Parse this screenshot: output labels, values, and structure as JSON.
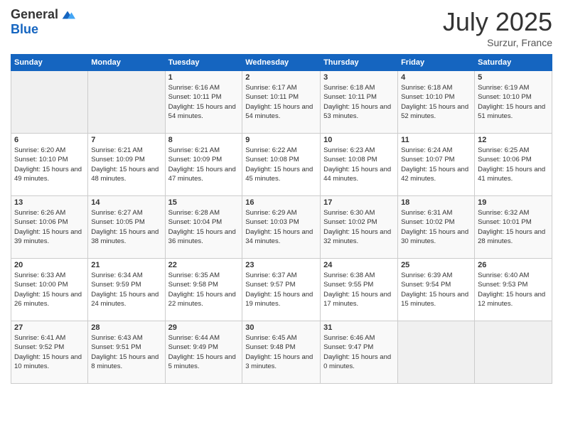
{
  "logo": {
    "general": "General",
    "blue": "Blue"
  },
  "header": {
    "month": "July 2025",
    "location": "Surzur, France"
  },
  "weekdays": [
    "Sunday",
    "Monday",
    "Tuesday",
    "Wednesday",
    "Thursday",
    "Friday",
    "Saturday"
  ],
  "weeks": [
    [
      {
        "day": "",
        "info": ""
      },
      {
        "day": "",
        "info": ""
      },
      {
        "day": "1",
        "info": "Sunrise: 6:16 AM\nSunset: 10:11 PM\nDaylight: 15 hours and 54 minutes."
      },
      {
        "day": "2",
        "info": "Sunrise: 6:17 AM\nSunset: 10:11 PM\nDaylight: 15 hours and 54 minutes."
      },
      {
        "day": "3",
        "info": "Sunrise: 6:18 AM\nSunset: 10:11 PM\nDaylight: 15 hours and 53 minutes."
      },
      {
        "day": "4",
        "info": "Sunrise: 6:18 AM\nSunset: 10:10 PM\nDaylight: 15 hours and 52 minutes."
      },
      {
        "day": "5",
        "info": "Sunrise: 6:19 AM\nSunset: 10:10 PM\nDaylight: 15 hours and 51 minutes."
      }
    ],
    [
      {
        "day": "6",
        "info": "Sunrise: 6:20 AM\nSunset: 10:10 PM\nDaylight: 15 hours and 49 minutes."
      },
      {
        "day": "7",
        "info": "Sunrise: 6:21 AM\nSunset: 10:09 PM\nDaylight: 15 hours and 48 minutes."
      },
      {
        "day": "8",
        "info": "Sunrise: 6:21 AM\nSunset: 10:09 PM\nDaylight: 15 hours and 47 minutes."
      },
      {
        "day": "9",
        "info": "Sunrise: 6:22 AM\nSunset: 10:08 PM\nDaylight: 15 hours and 45 minutes."
      },
      {
        "day": "10",
        "info": "Sunrise: 6:23 AM\nSunset: 10:08 PM\nDaylight: 15 hours and 44 minutes."
      },
      {
        "day": "11",
        "info": "Sunrise: 6:24 AM\nSunset: 10:07 PM\nDaylight: 15 hours and 42 minutes."
      },
      {
        "day": "12",
        "info": "Sunrise: 6:25 AM\nSunset: 10:06 PM\nDaylight: 15 hours and 41 minutes."
      }
    ],
    [
      {
        "day": "13",
        "info": "Sunrise: 6:26 AM\nSunset: 10:06 PM\nDaylight: 15 hours and 39 minutes."
      },
      {
        "day": "14",
        "info": "Sunrise: 6:27 AM\nSunset: 10:05 PM\nDaylight: 15 hours and 38 minutes."
      },
      {
        "day": "15",
        "info": "Sunrise: 6:28 AM\nSunset: 10:04 PM\nDaylight: 15 hours and 36 minutes."
      },
      {
        "day": "16",
        "info": "Sunrise: 6:29 AM\nSunset: 10:03 PM\nDaylight: 15 hours and 34 minutes."
      },
      {
        "day": "17",
        "info": "Sunrise: 6:30 AM\nSunset: 10:02 PM\nDaylight: 15 hours and 32 minutes."
      },
      {
        "day": "18",
        "info": "Sunrise: 6:31 AM\nSunset: 10:02 PM\nDaylight: 15 hours and 30 minutes."
      },
      {
        "day": "19",
        "info": "Sunrise: 6:32 AM\nSunset: 10:01 PM\nDaylight: 15 hours and 28 minutes."
      }
    ],
    [
      {
        "day": "20",
        "info": "Sunrise: 6:33 AM\nSunset: 10:00 PM\nDaylight: 15 hours and 26 minutes."
      },
      {
        "day": "21",
        "info": "Sunrise: 6:34 AM\nSunset: 9:59 PM\nDaylight: 15 hours and 24 minutes."
      },
      {
        "day": "22",
        "info": "Sunrise: 6:35 AM\nSunset: 9:58 PM\nDaylight: 15 hours and 22 minutes."
      },
      {
        "day": "23",
        "info": "Sunrise: 6:37 AM\nSunset: 9:57 PM\nDaylight: 15 hours and 19 minutes."
      },
      {
        "day": "24",
        "info": "Sunrise: 6:38 AM\nSunset: 9:55 PM\nDaylight: 15 hours and 17 minutes."
      },
      {
        "day": "25",
        "info": "Sunrise: 6:39 AM\nSunset: 9:54 PM\nDaylight: 15 hours and 15 minutes."
      },
      {
        "day": "26",
        "info": "Sunrise: 6:40 AM\nSunset: 9:53 PM\nDaylight: 15 hours and 12 minutes."
      }
    ],
    [
      {
        "day": "27",
        "info": "Sunrise: 6:41 AM\nSunset: 9:52 PM\nDaylight: 15 hours and 10 minutes."
      },
      {
        "day": "28",
        "info": "Sunrise: 6:43 AM\nSunset: 9:51 PM\nDaylight: 15 hours and 8 minutes."
      },
      {
        "day": "29",
        "info": "Sunrise: 6:44 AM\nSunset: 9:49 PM\nDaylight: 15 hours and 5 minutes."
      },
      {
        "day": "30",
        "info": "Sunrise: 6:45 AM\nSunset: 9:48 PM\nDaylight: 15 hours and 3 minutes."
      },
      {
        "day": "31",
        "info": "Sunrise: 6:46 AM\nSunset: 9:47 PM\nDaylight: 15 hours and 0 minutes."
      },
      {
        "day": "",
        "info": ""
      },
      {
        "day": "",
        "info": ""
      }
    ]
  ]
}
